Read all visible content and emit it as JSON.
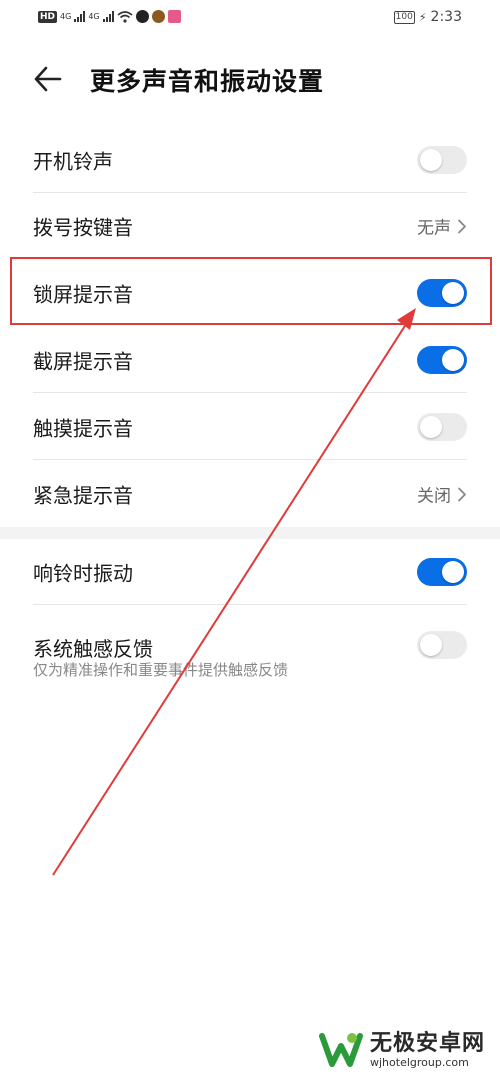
{
  "status_bar": {
    "hd": "HD",
    "network_1": "4G",
    "network_2": "4G",
    "battery": "100",
    "time": "2:33"
  },
  "header": {
    "title": "更多声音和振动设置",
    "back_icon": "arrow-left-icon"
  },
  "settings": [
    {
      "label": "开机铃声",
      "type": "toggle",
      "on": false
    },
    {
      "label": "拨号按键音",
      "type": "value",
      "value": "无声"
    },
    {
      "label": "锁屏提示音",
      "type": "toggle",
      "on": true
    },
    {
      "label": "截屏提示音",
      "type": "toggle",
      "on": true
    },
    {
      "label": "触摸提示音",
      "type": "toggle",
      "on": false
    },
    {
      "label": "紧急提示音",
      "type": "value",
      "value": "关闭"
    }
  ],
  "vibration": [
    {
      "label": "响铃时振动",
      "type": "toggle",
      "on": true
    },
    {
      "label": "系统触感反馈",
      "sublabel": "仅为精准操作和重要事件提供触感反馈",
      "type": "toggle",
      "on": false
    }
  ],
  "watermark": {
    "title": "无极安卓网",
    "url": "wjhotelgroup.com"
  },
  "colors": {
    "toggle_on": "#0a6ee6",
    "toggle_off": "#ebebeb",
    "annotation": "#e03a3a"
  }
}
